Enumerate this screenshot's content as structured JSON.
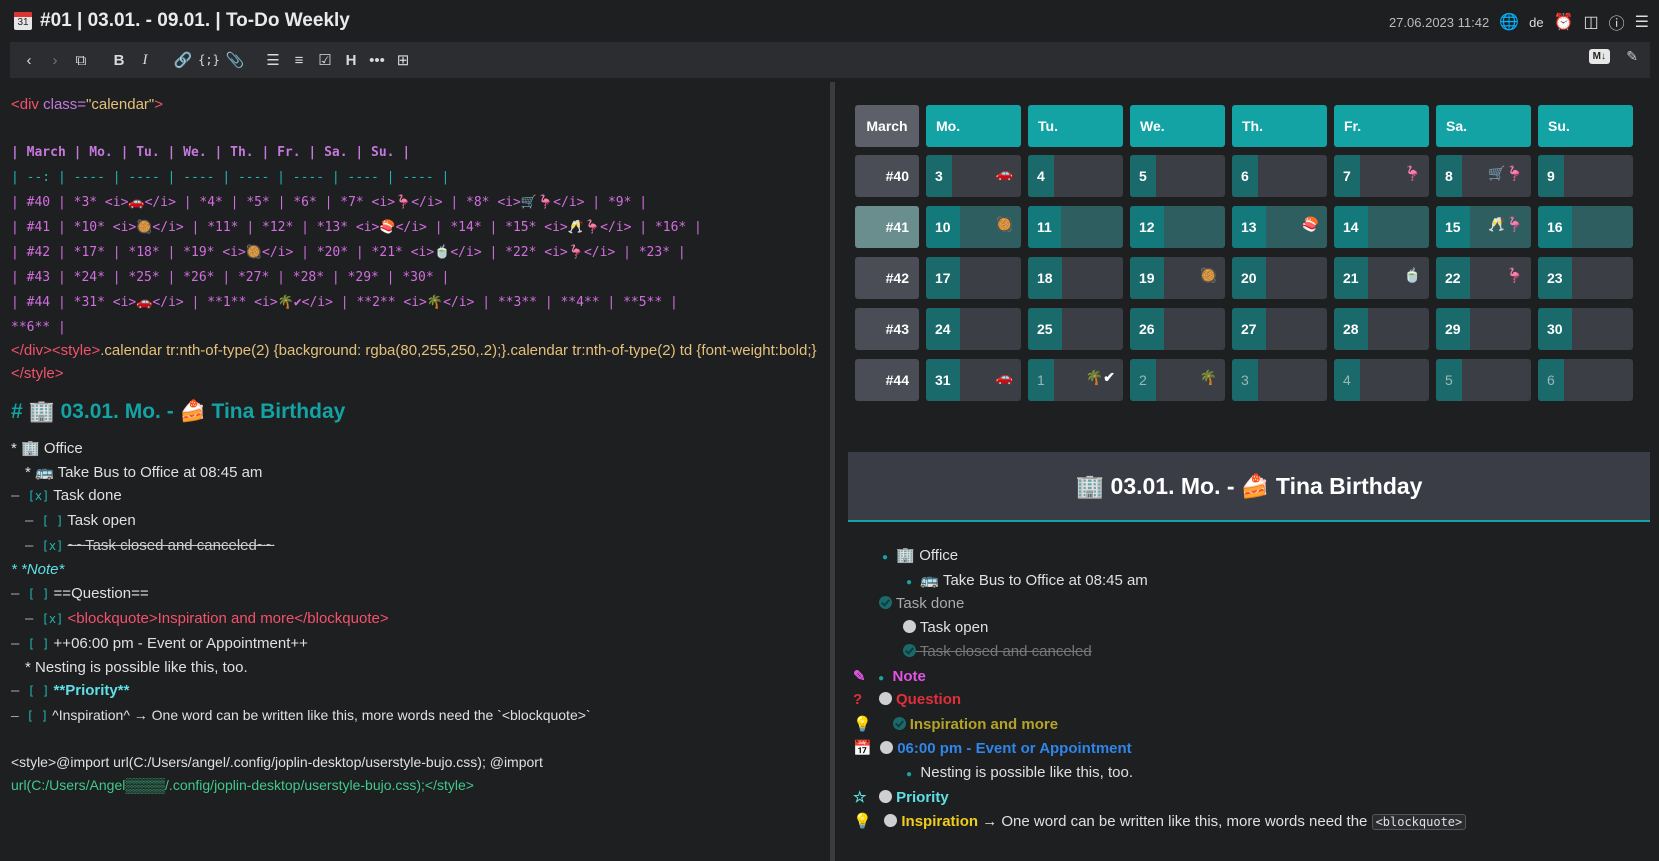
{
  "window": {
    "title": "#01 | 03.01. - 09.01. | To-Do Weekly",
    "datetime": "27.06.2023 11:42",
    "language": "de"
  },
  "toolbar": {
    "md_badge": "M↓"
  },
  "editor": {
    "l1_tag_open": "<div",
    "l1_attr": " class=",
    "l1_str": "\"calendar\"",
    "l1_close": ">",
    "table_rows": [
      "| March |  Mo. |  Tu. |  We. |  Th. |  Fr. |  Sa. |  Su. |",
      "| --: | ---- | ---- | ---- | ---- | ---- | ---- | ---- |",
      "| #40 | *3* <i>🚗</i> | *4* | *5* | *6* | *7* <i>🦩</i> | *8* <i>🛒🦩</i> | *9* |",
      "| #41 | *10* <i>🥘</i> | *11* | *12* | *13* <i>🍣</i> | *14* | *15* <i>🥂🦩</i> | *16* |",
      "| #42 | *17* | *18* | *19* <i>🥘</i> | *20* | *21* <i>🍵</i> | *22* <i>🦩</i> | *23* |",
      "| #43 | *24* | *25* | *26* | *27* | *28* | *29* | *30* |",
      "| #44 | *31* <i>🚗</i> | **1** <i>🌴✔</i> | **2** <i>🌴</i> | **3** | **4** |  **5** |",
      "**6** |"
    ],
    "style_line1_a": "</div><style>",
    "style_line1_b": ".calendar tr:nth-of-type(2) {background: rgba(80,255,250,.2);}.calendar tr:nth-of-type(2) td {font-weight:bold;}",
    "style_line2": "</style>",
    "heading": "# 🏢 03.01. Mo. - 🍰 Tina Birthday",
    "lines": [
      "* 🏢 Office",
      "* 🚌 Take Bus to Office at 08:45 am",
      "Task done",
      "Task open",
      "~~Task closed and canceled~~",
      "* *Note*",
      "==Question==",
      "<blockquote>Inspiration and more</blockquote>",
      "++06:00 pm - Event or Appointment++",
      "* Nesting is possible like this, too.",
      "**Priority**",
      "^Inspiration^ → One word can be written like this, more words need the `<blockquote>`"
    ],
    "cb_x": "[x]",
    "cb_empty": "[ ]",
    "dash": "–",
    "import1": "<style>@import url(C:/Users/angel/.config/joplin-desktop/userstyle-bujo.css); @import",
    "import2": "url(C:/Users/Angel▒▒▒▒/.config/joplin-desktop/userstyle-bujo.css);</style>"
  },
  "calendar": {
    "month": "March",
    "days": [
      "Mo.",
      "Tu.",
      "We.",
      "Th.",
      "Fr.",
      "Sa.",
      "Su."
    ],
    "weeks": [
      {
        "label": "#40",
        "cells": [
          [
            "3",
            "🚗"
          ],
          [
            "4",
            ""
          ],
          [
            "5",
            ""
          ],
          [
            "6",
            ""
          ],
          [
            "7",
            "🦩"
          ],
          [
            "8",
            "🛒🦩"
          ],
          [
            "9",
            ""
          ]
        ]
      },
      {
        "label": "#41",
        "cells": [
          [
            "10",
            "🥘"
          ],
          [
            "11",
            ""
          ],
          [
            "12",
            ""
          ],
          [
            "13",
            "🍣"
          ],
          [
            "14",
            ""
          ],
          [
            "15",
            "🥂🦩"
          ],
          [
            "16",
            ""
          ]
        ]
      },
      {
        "label": "#42",
        "cells": [
          [
            "17",
            ""
          ],
          [
            "18",
            ""
          ],
          [
            "19",
            "🥘"
          ],
          [
            "20",
            ""
          ],
          [
            "21",
            "🍵"
          ],
          [
            "22",
            "🦩"
          ],
          [
            "23",
            ""
          ]
        ]
      },
      {
        "label": "#43",
        "cells": [
          [
            "24",
            ""
          ],
          [
            "25",
            ""
          ],
          [
            "26",
            ""
          ],
          [
            "27",
            ""
          ],
          [
            "28",
            ""
          ],
          [
            "29",
            ""
          ],
          [
            "30",
            ""
          ]
        ]
      },
      {
        "label": "#44",
        "cells": [
          [
            "31",
            "🚗"
          ],
          [
            "1",
            "🌴✔"
          ],
          [
            "2",
            "🌴"
          ],
          [
            "3",
            ""
          ],
          [
            "4",
            ""
          ],
          [
            "5",
            ""
          ],
          [
            "6",
            ""
          ]
        ]
      }
    ]
  },
  "viewer": {
    "heading": "🏢 03.01. Mo. - 🍰 Tina Birthday",
    "office": "🏢 Office",
    "bus": "🚌 Take Bus to Office at 08:45 am",
    "task_done": "Task done",
    "task_open": "Task open",
    "task_canceled": "Task closed and canceled",
    "note": "Note",
    "question": "Question",
    "inspiration_more": "Inspiration and more",
    "event": "06:00 pm - Event or Appointment",
    "nesting": "Nesting is possible like this, too.",
    "priority": "Priority",
    "inspiration": "Inspiration",
    "inspiration_rest": " → One word can be written like this, more words need the ",
    "blockquote_code": "<blockquote>"
  },
  "colors": {
    "accent_teal": "#13a3a4",
    "tag_red": "#f4516c",
    "note_magenta": "#e056e0",
    "question_red": "#e02f3a",
    "inspiration_olive": "#b5a327",
    "event_blue": "#2f86e8",
    "priority_cyan": "#5ee0e6",
    "inspiration_yellow": "#f0cc1d"
  }
}
